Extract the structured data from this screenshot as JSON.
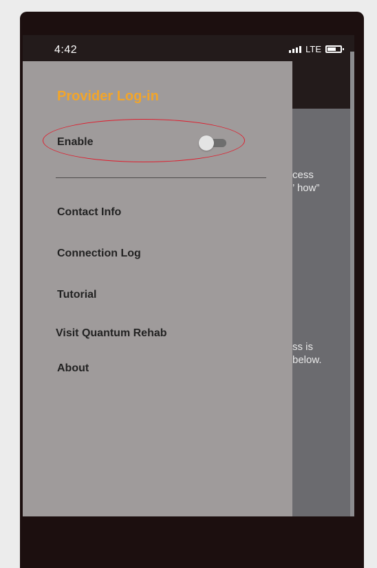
{
  "status_bar": {
    "time": "4:42",
    "network": "LTE",
    "icons": [
      "signal-icon",
      "battery-icon"
    ]
  },
  "background_content": {
    "line1": "cess",
    "line2": "’ how”",
    "line3": "ss is",
    "line4": "below."
  },
  "drawer": {
    "title": "Provider Log-in",
    "enable_label": "Enable",
    "enable_toggle_on": false,
    "menu": [
      {
        "label": "Contact Info"
      },
      {
        "label": "Connection Log"
      },
      {
        "label": "Tutorial"
      },
      {
        "label": "Visit Quantum Rehab"
      },
      {
        "label": "About"
      }
    ]
  },
  "colors": {
    "title_accent": "#f2a52a",
    "highlight_circle": "#e01c2c",
    "drawer_bg": "#9f9b9b"
  }
}
